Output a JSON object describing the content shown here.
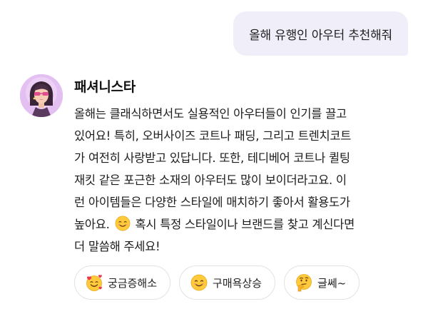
{
  "user_message": "올해 유행인 아우터 추천해줘",
  "bot": {
    "name": "패셔니스타",
    "avatar_icon": "fashion-woman-avatar",
    "message_lines": [
      "올해는 클래식하면서도 실용적인 아우터들이 인기를 끌고",
      "있어요! 특히, 오버사이즈 코트나 패딩, 그리고 트렌치코트",
      "가 여전히 사랑받고 있답니다. 또한, 테디베어 코트나 퀼팅",
      "재킷 같은 포근한 소재의 아우터도 많이 보이더라고요. 이",
      "런 아이템들은 다양한 스타일에 매치하기 좋아서 활용도가"
    ],
    "line6_before_emoji": "높아요.",
    "line6_after_emoji": "혹시 특정 스타일이나 브랜드를 찾고 계신다면",
    "line7": "더 말씀해 주세요!",
    "inline_emoji_icon": "smiling-face-icon"
  },
  "suggestions": [
    {
      "label": "궁금증해소",
      "icon": "smiling-face-with-hearts-icon"
    },
    {
      "label": "구매욕상승",
      "icon": "smiling-face-icon"
    },
    {
      "label": "글쎄~",
      "icon": "thinking-face-icon"
    }
  ]
}
